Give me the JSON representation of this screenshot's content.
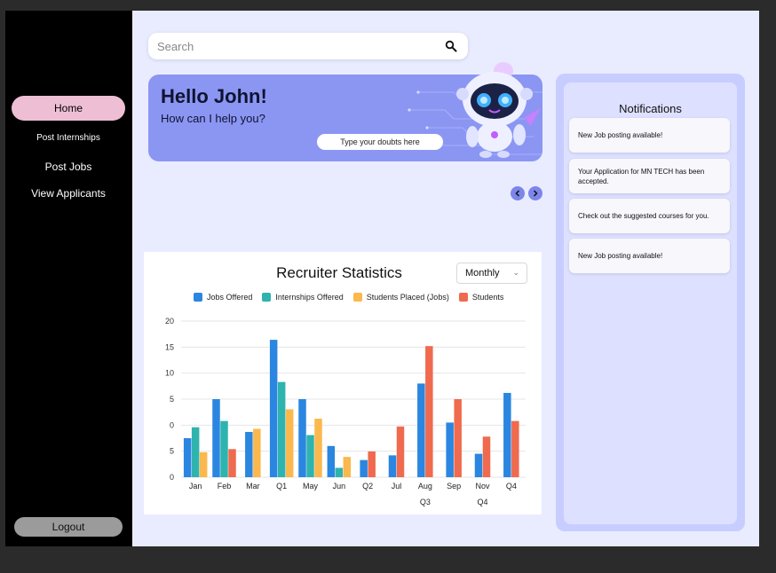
{
  "sidebar": {
    "items": [
      {
        "label": "Home",
        "active": true
      },
      {
        "label": "Post Internships",
        "active": false
      },
      {
        "label": "Post Jobs",
        "active": false
      },
      {
        "label": "View Applicants",
        "active": false
      }
    ],
    "logout_label": "Logout"
  },
  "search": {
    "placeholder": "Search",
    "icon": "search-icon"
  },
  "banner": {
    "greeting": "Hello John!",
    "subtitle": "How can I help you?",
    "doubt_placeholder": "Type your doubts here",
    "color": "#8b96f3"
  },
  "carousel": {
    "prev_icon": "chevron-left-icon",
    "next_icon": "chevron-right-icon"
  },
  "stats": {
    "title": "Recruiter Statistics",
    "period": "Monthly"
  },
  "chart_data": {
    "type": "bar",
    "title": "Recruiter Statistics",
    "categories": [
      "Jan",
      "Feb",
      "Mar",
      "Q1",
      "May",
      "Jun",
      "Q2",
      "Jul",
      "Aug",
      "Sep",
      "Nov",
      "Q4"
    ],
    "xlabels_second_row": [
      "",
      "",
      "",
      "",
      "",
      "",
      "",
      "",
      "Q3",
      "",
      "Q4",
      ""
    ],
    "ytick_labels": [
      "20",
      "15",
      "10",
      "5",
      "0",
      "5",
      "0"
    ],
    "ylim": [
      0,
      20
    ],
    "grid": true,
    "legend_position": "top",
    "series": [
      {
        "name": "Jobs Offered",
        "color": "#2a86e0",
        "values": [
          5,
          10,
          5.8,
          17.6,
          10,
          4,
          2.2,
          2.8,
          12,
          7,
          3,
          10.8
        ]
      },
      {
        "name": "Internships Offered",
        "color": "#2fb3ae",
        "values": [
          6.4,
          7.2,
          null,
          12.2,
          5.4,
          1.2,
          null,
          null,
          null,
          null,
          null,
          null
        ]
      },
      {
        "name": "Students Placed (Jobs)",
        "color": "#fbb84d",
        "values": [
          3.2,
          null,
          6.2,
          8.7,
          7.5,
          2.6,
          null,
          null,
          null,
          null,
          null,
          null
        ]
      },
      {
        "name": "Students",
        "color": "#ef6a4e",
        "values": [
          null,
          3.6,
          null,
          null,
          null,
          null,
          3.3,
          6.5,
          16.8,
          10,
          5.2,
          7.2
        ]
      }
    ]
  },
  "notifications": {
    "title": "Notifications",
    "items": [
      "New Job posting available!",
      "Your Application for MN TECH has been accepted.",
      "Check out the suggested courses for you.",
      "New Job posting available!"
    ]
  }
}
